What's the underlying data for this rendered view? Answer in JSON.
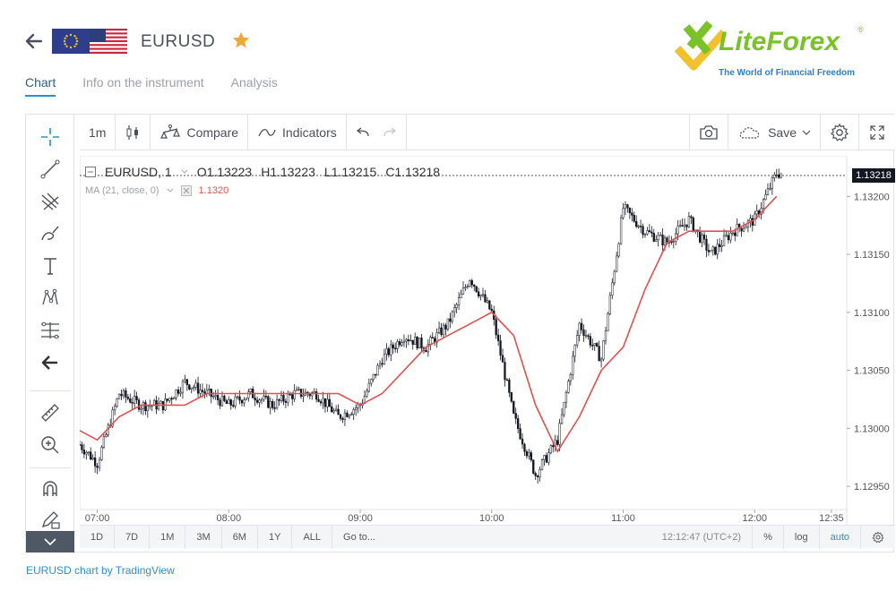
{
  "header": {
    "symbol": "EURUSD",
    "tabs": [
      {
        "label": "Chart",
        "active": true
      },
      {
        "label": "Info on the instrument",
        "active": false
      },
      {
        "label": "Analysis",
        "active": false
      }
    ],
    "logo": {
      "name": "LiteForex",
      "reg": "®",
      "tagline": "The World of Financial Freedom"
    }
  },
  "toolbar": {
    "interval": "1m",
    "compare": "Compare",
    "indicators": "Indicators",
    "save": "Save"
  },
  "legend": {
    "symbol": "EURUSD, 1",
    "open_label": "O",
    "open": "1.13223",
    "high_label": "H",
    "high": "1.13223",
    "low_label": "L",
    "low": "1.13215",
    "close_label": "C",
    "close": "1.13218",
    "ma_label": "MA (21, close, 0)",
    "ma_value": "1.1320"
  },
  "price_badge": "1.13218",
  "bottom_bar": {
    "ranges": [
      "1D",
      "7D",
      "1M",
      "3M",
      "6M",
      "1Y",
      "ALL"
    ],
    "goto": "Go to...",
    "time": "12:12:47 (UTC+2)",
    "percent": "%",
    "log": "log",
    "auto": "auto"
  },
  "footer": {
    "link": "EURUSD chart by TradingView"
  },
  "colors": {
    "candle": "#131722",
    "ma": "#e25151",
    "accent": "#2b8fd6",
    "logo_green": "#7bc22a",
    "logo_yellow": "#f2c12e"
  },
  "chart_data": {
    "type": "line",
    "y_ticks": [
      "1.13200",
      "1.13150",
      "1.13100",
      "1.13050",
      "1.13000",
      "1.12950"
    ],
    "x_ticks": [
      "07:00",
      "08:00",
      "09:00",
      "10:00",
      "11:00",
      "12:00",
      "12:35"
    ],
    "ylim": [
      1.1293,
      1.13235
    ],
    "last_price": 1.13218,
    "series": [
      {
        "name": "EURUSD, 1",
        "x": [
          "06:50",
          "07:00",
          "07:10",
          "07:20",
          "07:30",
          "07:40",
          "07:50",
          "08:00",
          "08:10",
          "08:20",
          "08:30",
          "08:40",
          "08:50",
          "09:00",
          "09:10",
          "09:20",
          "09:30",
          "09:40",
          "09:50",
          "10:00",
          "10:10",
          "10:20",
          "10:30",
          "10:40",
          "10:50",
          "11:00",
          "11:10",
          "11:20",
          "11:30",
          "11:40",
          "11:50",
          "12:00",
          "12:10"
        ],
        "values": [
          1.1299,
          1.1297,
          1.1303,
          1.1302,
          1.1302,
          1.1304,
          1.1303,
          1.1302,
          1.1303,
          1.1302,
          1.1303,
          1.1303,
          1.1301,
          1.1302,
          1.1306,
          1.1308,
          1.1307,
          1.1309,
          1.1313,
          1.131,
          1.1301,
          1.1296,
          1.1299,
          1.1309,
          1.1306,
          1.1319,
          1.1317,
          1.1316,
          1.1318,
          1.1315,
          1.1317,
          1.1318,
          1.1322
        ]
      },
      {
        "name": "MA (21, close, 0)",
        "x": [
          "06:50",
          "07:00",
          "07:10",
          "07:20",
          "07:30",
          "07:40",
          "07:50",
          "08:00",
          "08:10",
          "08:20",
          "08:30",
          "08:40",
          "08:50",
          "09:00",
          "09:10",
          "09:20",
          "09:30",
          "09:40",
          "09:50",
          "10:00",
          "10:10",
          "10:20",
          "10:30",
          "10:40",
          "10:50",
          "11:00",
          "11:10",
          "11:20",
          "11:30",
          "11:40",
          "11:50",
          "12:00",
          "12:10"
        ],
        "values": [
          1.13,
          1.1299,
          1.1301,
          1.1302,
          1.1302,
          1.1302,
          1.1303,
          1.1303,
          1.1303,
          1.1303,
          1.1303,
          1.1303,
          1.1303,
          1.1302,
          1.1303,
          1.1305,
          1.1307,
          1.1308,
          1.1309,
          1.131,
          1.1308,
          1.1302,
          1.1298,
          1.1301,
          1.1305,
          1.1307,
          1.1312,
          1.1316,
          1.1317,
          1.1317,
          1.1317,
          1.1318,
          1.132
        ]
      }
    ]
  }
}
